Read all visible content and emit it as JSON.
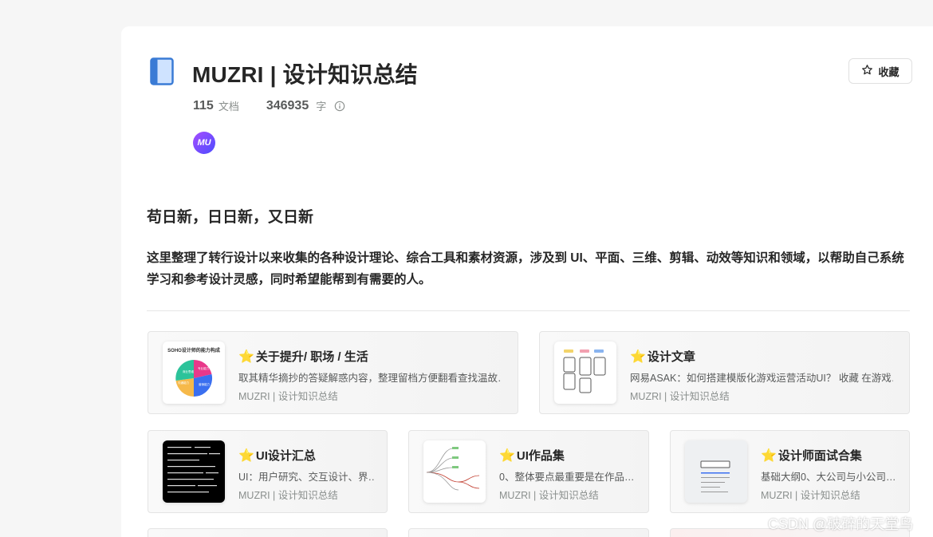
{
  "book": {
    "icon": "book-icon",
    "title": "MUZRI | 设计知识总结",
    "favorite_label": "收藏",
    "doc_count": "115",
    "doc_unit": "文档",
    "word_count": "346935",
    "word_unit": "字",
    "avatar_text": "MU"
  },
  "intro": {
    "heading": "苟日新，日日新，又日新",
    "description": "这里整理了转行设计以来收集的各种设计理论、综合工具和素材资源，涉及到 UI、平面、三维、剪辑、动效等知识和领域，以帮助自己系统学习和参考设计灵感，同时希望能帮到有需要的人。"
  },
  "cards": [
    {
      "title": "关于提升/ 职场 / 生活",
      "summary": "取其精华摘抄的答疑解惑内容，整理留档方便翻看查找温故…",
      "source": "MUZRI | 设计知识总结",
      "thumb_caption": "SOHO设计师的能力构成",
      "thumb_slices": [
        "商业思维",
        "专业能力",
        "沟通能力",
        "营销能力"
      ]
    },
    {
      "title": "设计文章",
      "summary": "网易ASAK：如何搭建模版化游戏运营活动UI？ 收藏 在游戏…",
      "source": "MUZRI | 设计知识总结"
    },
    {
      "title": "UI设计汇总",
      "summary": "UI：用户研究、交互设计、界…",
      "source": "MUZRI | 设计知识总结"
    },
    {
      "title": "UI作品集",
      "summary": "0、整体要点最重要是在作品…",
      "source": "MUZRI | 设计知识总结"
    },
    {
      "title": "设计师面试合集",
      "summary": "基础大纲0、大公司与小公司…",
      "source": "MUZRI | 设计知识总结"
    }
  ],
  "watermark": "CSDN @破碎的天堂鸟",
  "colors": {
    "star": "#f6b900",
    "avatar_gradient_start": "#a64dff",
    "avatar_gradient_end": "#4c4cff",
    "book_icon": "#4a90e2"
  }
}
